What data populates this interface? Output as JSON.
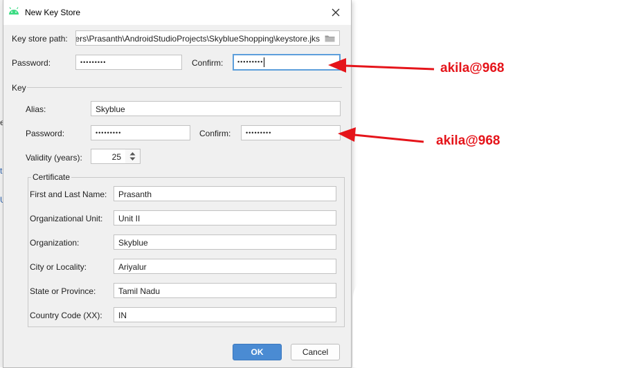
{
  "dialog": {
    "title": "New Key Store",
    "key_store_path_label": "Key store path:",
    "key_store_path_value": "C:\\Users\\Prasanth\\AndroidStudioProjects\\SkyblueShopping\\keystore.jks",
    "password_label": "Password:",
    "password_value": "•••••••••",
    "confirm_label": "Confirm:",
    "confirm_value": "•••••••••",
    "key_section_label": "Key",
    "alias_label": "Alias:",
    "alias_value": "Skyblue",
    "key_password_label": "Password:",
    "key_password_value": "•••••••••",
    "key_confirm_label": "Confirm:",
    "key_confirm_value": "•••••••••",
    "validity_label": "Validity (years):",
    "validity_value": "25",
    "certificate_label": "Certificate",
    "certificate_fields": [
      {
        "label": "First and Last Name:",
        "value": "Prasanth"
      },
      {
        "label": "Organizational Unit:",
        "value": "Unit II"
      },
      {
        "label": "Organization:",
        "value": "Skyblue"
      },
      {
        "label": "City or Locality:",
        "value": "Ariyalur"
      },
      {
        "label": "State or Province:",
        "value": "Tamil Nadu"
      },
      {
        "label": "Country Code (XX):",
        "value": "IN"
      }
    ],
    "ok_label": "OK",
    "cancel_label": "Cancel"
  },
  "annotations": {
    "store_password_note": "akila@968",
    "key_password_note": "akila@968"
  },
  "background_fragments": [
    "e",
    "",
    "t",
    "U"
  ],
  "colors": {
    "annotation_red": "#e5141a",
    "ok_button": "#4a8bd3",
    "focus_border": "#5c9edb",
    "android_green": "#3ddc84"
  },
  "icons": {
    "title": "android-icon",
    "close": "close-icon",
    "browse": "folder-icon",
    "spinner": "spinner-arrows-icon"
  }
}
